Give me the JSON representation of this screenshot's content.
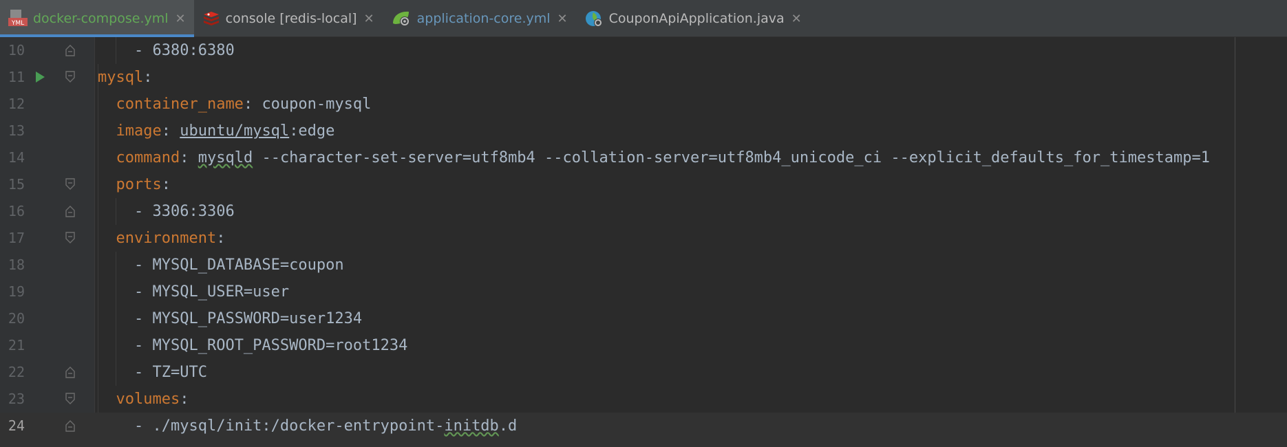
{
  "tabs": [
    {
      "label": "docker-compose.yml",
      "icon": "yml-file-icon",
      "color": "#62a857",
      "active": true
    },
    {
      "label": "console [redis-local]",
      "icon": "redis-icon",
      "color": "#bbbbbb",
      "active": false
    },
    {
      "label": "application-core.yml",
      "icon": "spring-config-icon",
      "color": "#6897bb",
      "active": false
    },
    {
      "label": "CouponApiApplication.java",
      "icon": "spring-app-icon",
      "color": "#bbbbbb",
      "active": false
    }
  ],
  "icon_texts": {
    "yml": "YML"
  },
  "editor": {
    "current_line": 24,
    "lines": [
      {
        "num": "10",
        "indent": "    ",
        "dash": "- ",
        "key": "",
        "sep": "",
        "value": "6380:6380"
      },
      {
        "num": "11",
        "indent": "",
        "dash": "",
        "key": "mysql",
        "sep": ":",
        "value": ""
      },
      {
        "num": "12",
        "indent": "  ",
        "dash": "",
        "key": "container_name",
        "sep": ": ",
        "value": "coupon-mysql"
      },
      {
        "num": "13",
        "indent": "  ",
        "dash": "",
        "key": "image",
        "sep": ": ",
        "value_ul": "ubuntu/mysql",
        "value": ":edge"
      },
      {
        "num": "14",
        "indent": "  ",
        "dash": "",
        "key": "command",
        "sep": ": ",
        "value_sq": "mysqld",
        "value": " --character-set-server=utf8mb4 --collation-server=utf8mb4_unicode_ci --explicit_defaults_for_timestamp=1"
      },
      {
        "num": "15",
        "indent": "  ",
        "dash": "",
        "key": "ports",
        "sep": ":",
        "value": ""
      },
      {
        "num": "16",
        "indent": "    ",
        "dash": "- ",
        "key": "",
        "sep": "",
        "value": "3306:3306"
      },
      {
        "num": "17",
        "indent": "  ",
        "dash": "",
        "key": "environment",
        "sep": ":",
        "value": ""
      },
      {
        "num": "18",
        "indent": "    ",
        "dash": "- ",
        "key": "",
        "sep": "",
        "value": "MYSQL_DATABASE=coupon"
      },
      {
        "num": "19",
        "indent": "    ",
        "dash": "- ",
        "key": "",
        "sep": "",
        "value": "MYSQL_USER=user"
      },
      {
        "num": "20",
        "indent": "    ",
        "dash": "- ",
        "key": "",
        "sep": "",
        "value": "MYSQL_PASSWORD=user1234"
      },
      {
        "num": "21",
        "indent": "    ",
        "dash": "- ",
        "key": "",
        "sep": "",
        "value": "MYSQL_ROOT_PASSWORD=root1234"
      },
      {
        "num": "22",
        "indent": "    ",
        "dash": "- ",
        "key": "",
        "sep": "",
        "value": "TZ=UTC"
      },
      {
        "num": "23",
        "indent": "  ",
        "dash": "",
        "key": "volumes",
        "sep": ":",
        "value": ""
      },
      {
        "num": "24",
        "indent": "    ",
        "dash": "- ",
        "key": "",
        "sep": "",
        "value_pre": "./mysql/init:/docker-entrypoint-",
        "value_sq": "initdb",
        "value": ".d"
      }
    ]
  },
  "colors": {
    "background": "#2b2b2b",
    "gutter": "#313335",
    "key": "#cc7832",
    "text": "#a9b7c6",
    "line_number": "#606366",
    "run": "#499c54",
    "active_tab_underline": "#4a88c7"
  }
}
